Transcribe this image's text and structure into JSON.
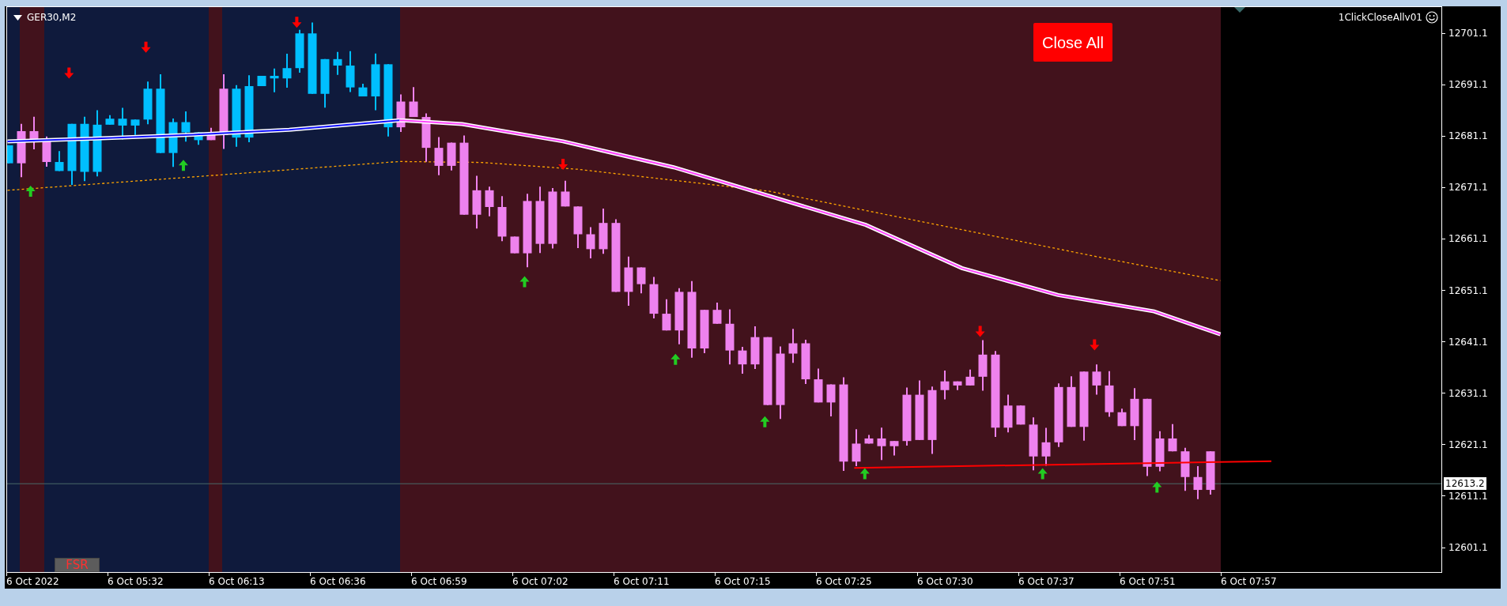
{
  "chart": {
    "symbol": "GER30,M2",
    "indicator_label": "1ClickCloseAllv01",
    "close_button": "Close All",
    "fsr_label": "FSR",
    "price_labels": [
      "12701.1",
      "12691.1",
      "12681.1",
      "12671.1",
      "12661.1",
      "12651.1",
      "12641.1",
      "12631.1",
      "12621.1",
      "12611.1",
      "12601.1"
    ],
    "current_price": "12613.2",
    "time_labels": [
      "6 Oct 2022",
      "6 Oct 05:32",
      "6 Oct 06:13",
      "6 Oct 06:36",
      "6 Oct 06:59",
      "6 Oct 07:02",
      "6 Oct 07:11",
      "6 Oct 07:15",
      "6 Oct 07:25",
      "6 Oct 07:30",
      "6 Oct 07:37",
      "6 Oct 07:51",
      "6 Oct 07:57"
    ]
  }
}
